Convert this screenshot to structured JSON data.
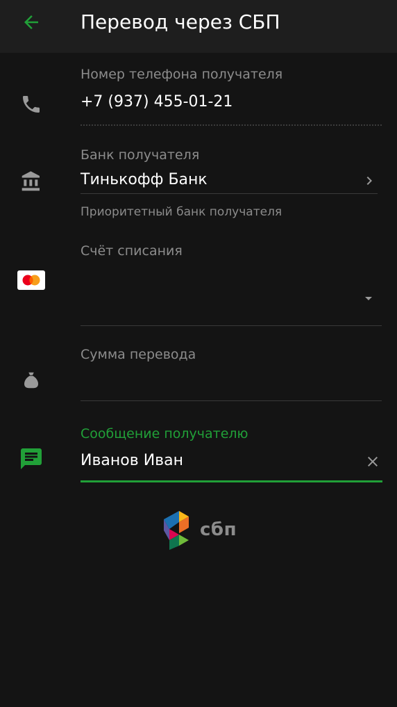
{
  "header": {
    "title": "Перевод через СБП"
  },
  "phone": {
    "label": "Номер телефона получателя",
    "value": "+7 (937) 455-01-21"
  },
  "bank": {
    "label": "Банк получателя",
    "value": "Тинькофф Банк",
    "hint": "Приоритетный банк получателя"
  },
  "account": {
    "label": "Счёт списания",
    "value": ""
  },
  "amount": {
    "label": "Сумма перевода",
    "value": ""
  },
  "message": {
    "label": "Сообщение получателю",
    "value": "Иванов Иван"
  },
  "logo": {
    "text": "сбп"
  },
  "colors": {
    "accent": "#21a038",
    "background": "#141414",
    "header": "#1e1e1e",
    "muted": "#8c8c8c"
  },
  "icons": [
    "back-arrow-icon",
    "phone-icon",
    "bank-icon",
    "mastercard-icon",
    "money-bag-icon",
    "message-icon",
    "chevron-right-icon",
    "dropdown-arrow-icon",
    "clear-icon"
  ]
}
